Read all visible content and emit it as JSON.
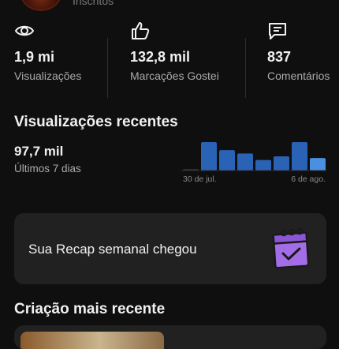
{
  "header": {
    "caption": "Inscritos"
  },
  "stats": [
    {
      "icon": "eye-icon",
      "value": "1,9 mi",
      "label": "Visualizações"
    },
    {
      "icon": "thumbs-up-icon",
      "value": "132,8 mil",
      "label": "Marcações Gostei"
    },
    {
      "icon": "comment-icon",
      "value": "837",
      "label": "Comentários"
    }
  ],
  "recent_views": {
    "title": "Visualizações recentes",
    "value": "97,7 mil",
    "period": "Últimos 7 dias"
  },
  "chart_data": {
    "type": "bar",
    "categories": [
      "",
      "",
      "",
      "",
      "",
      "",
      ""
    ],
    "values": [
      0.05,
      1.0,
      0.72,
      0.6,
      0.37,
      0.5,
      1.0,
      0.44
    ],
    "start_label": "30 de jul.",
    "end_label": "6 de ago.",
    "colors": {
      "bar": "#2a63b5",
      "last_bar": "#4a8fe0",
      "baseline": "#3a3a3a"
    }
  },
  "recap": {
    "text": "Sua Recap semanal chegou",
    "icon": "calendar-check-icon",
    "icon_color": "#a46de8"
  },
  "latest": {
    "title": "Criação mais recente"
  }
}
